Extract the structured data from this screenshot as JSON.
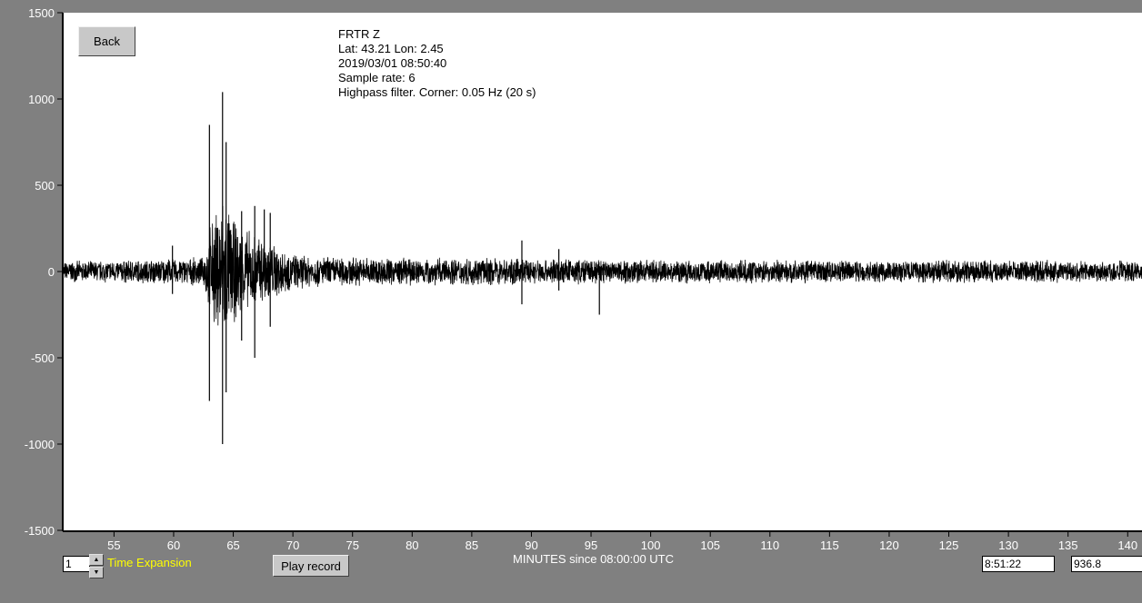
{
  "back_label": "Back",
  "info": {
    "station": "FRTR  Z",
    "latlon": "Lat: 43.21 Lon: 2.45",
    "datetime": "2019/03/01 08:50:40",
    "sample_rate": "Sample rate: 6",
    "filter": "Highpass filter. Corner: 0.05 Hz (20 s)"
  },
  "controls": {
    "time_expansion_value": "1",
    "time_expansion_label": "Time Expansion",
    "play_label": "Play record",
    "cursor_time": "8:51:22",
    "cursor_value": "936.8"
  },
  "colors": {
    "background": "#808080",
    "plot_bg": "#ffffff",
    "trace": "#000000",
    "label_text": "#ffffff",
    "time_expansion_text": "#ffff00"
  },
  "chart_data": {
    "type": "line",
    "xlabel": "MINUTES since 08:00:00 UTC",
    "ylabel": "",
    "xlim": [
      50.7,
      141.2
    ],
    "ylim": [
      -1500,
      1500
    ],
    "xticks": [
      55,
      60,
      65,
      70,
      75,
      80,
      85,
      90,
      95,
      100,
      105,
      110,
      115,
      120,
      125,
      130,
      135,
      140
    ],
    "yticks": [
      1500,
      1000,
      500,
      0,
      -500,
      -1000,
      -1500
    ],
    "grid": false,
    "series": [
      {
        "envelope": [
          [
            50.7,
            60
          ],
          [
            52,
            65
          ],
          [
            55,
            70
          ],
          [
            60,
            80
          ],
          [
            62.5,
            85
          ],
          [
            63.1,
            300
          ],
          [
            63.5,
            350
          ],
          [
            64.1,
            500
          ],
          [
            65,
            320
          ],
          [
            66,
            260
          ],
          [
            67,
            230
          ],
          [
            68,
            200
          ],
          [
            69,
            150
          ],
          [
            70,
            110
          ],
          [
            72,
            95
          ],
          [
            75,
            90
          ],
          [
            80,
            85
          ],
          [
            85,
            85
          ],
          [
            90,
            80
          ],
          [
            95,
            80
          ],
          [
            100,
            75
          ],
          [
            110,
            70
          ],
          [
            120,
            70
          ],
          [
            130,
            70
          ],
          [
            141.2,
            70
          ]
        ],
        "spikes": [
          [
            59.9,
            150
          ],
          [
            59.9,
            -130
          ],
          [
            63.0,
            850
          ],
          [
            63.0,
            -750
          ],
          [
            64.1,
            1040
          ],
          [
            64.1,
            -1000
          ],
          [
            64.4,
            750
          ],
          [
            64.4,
            -700
          ],
          [
            65.7,
            350
          ],
          [
            65.7,
            -400
          ],
          [
            66.8,
            380
          ],
          [
            66.8,
            -500
          ],
          [
            67.6,
            360
          ],
          [
            68.1,
            340
          ],
          [
            68.1,
            -320
          ],
          [
            89.2,
            180
          ],
          [
            89.2,
            -190
          ],
          [
            92.3,
            130
          ],
          [
            92.3,
            -110
          ],
          [
            95.7,
            -250
          ]
        ]
      }
    ]
  }
}
